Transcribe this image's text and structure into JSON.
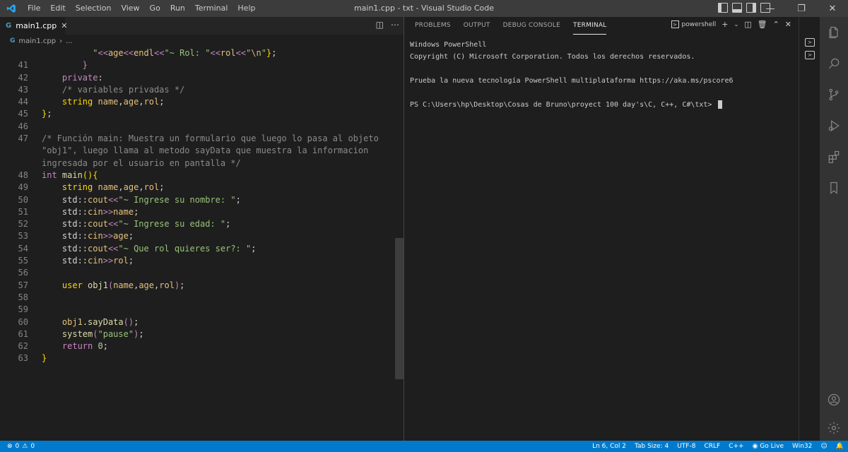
{
  "titlebar": {
    "menu": [
      "File",
      "Edit",
      "Selection",
      "View",
      "Go",
      "Run",
      "Terminal",
      "Help"
    ],
    "title": "main1.cpp - txt - Visual Studio Code"
  },
  "editor": {
    "tab_label": "main1.cpp",
    "breadcrumb_file": "main1.cpp",
    "breadcrumb_more": "...",
    "lines": [
      {
        "n": ""
      },
      {
        "n": "41"
      },
      {
        "n": "42"
      },
      {
        "n": "43"
      },
      {
        "n": "44"
      },
      {
        "n": "45"
      },
      {
        "n": "46"
      },
      {
        "n": "47"
      },
      {
        "n": ""
      },
      {
        "n": ""
      },
      {
        "n": "48"
      },
      {
        "n": "49"
      },
      {
        "n": "50"
      },
      {
        "n": "51"
      },
      {
        "n": "52"
      },
      {
        "n": "53"
      },
      {
        "n": "54"
      },
      {
        "n": "55"
      },
      {
        "n": "56"
      },
      {
        "n": "57"
      },
      {
        "n": "58"
      },
      {
        "n": "59"
      },
      {
        "n": "60"
      },
      {
        "n": "61"
      },
      {
        "n": "62"
      },
      {
        "n": "63"
      }
    ]
  },
  "panel": {
    "tabs": [
      "PROBLEMS",
      "OUTPUT",
      "DEBUG CONSOLE",
      "TERMINAL"
    ],
    "shell_label": "powershell",
    "terminal_lines": [
      "Windows PowerShell",
      "Copyright (C) Microsoft Corporation. Todos los derechos reservados.",
      "",
      "Prueba la nueva tecnología PowerShell multiplataforma https://aka.ms/pscore6",
      "",
      "PS C:\\Users\\hp\\Desktop\\Cosas de Bruno\\proyect 100 day's\\C, C++, C#\\txt> "
    ]
  },
  "statusbar": {
    "errors": "0",
    "warnings": "0",
    "position": "Ln 6, Col 2",
    "tab_size": "Tab Size: 4",
    "encoding": "UTF-8",
    "eol": "CRLF",
    "language": "C++",
    "go_live": "Go Live",
    "platform": "Win32"
  },
  "colors": {
    "statusbar": "#007acc",
    "titlebar": "#3c3c3c",
    "editor_bg": "#1e1e1e",
    "activity_bar": "#333333"
  }
}
